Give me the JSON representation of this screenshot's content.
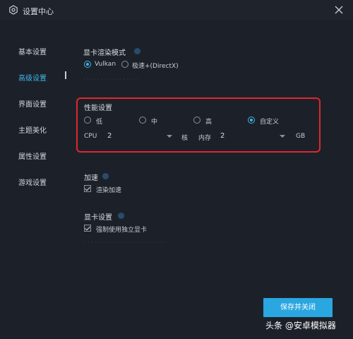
{
  "window": {
    "title": "设置中心"
  },
  "sidebar": {
    "items": [
      {
        "label": "基本设置"
      },
      {
        "label": "高级设置"
      },
      {
        "label": "界面设置"
      },
      {
        "label": "主题美化"
      },
      {
        "label": "属性设置"
      },
      {
        "label": "游戏设置"
      }
    ],
    "active_index": 1
  },
  "render": {
    "title": "显卡渲染模式",
    "option_vulkan": "Vulkan",
    "option_directx": "极速+(DirectX)",
    "selected": "Vulkan"
  },
  "performance": {
    "title": "性能设置",
    "options": [
      "低",
      "中",
      "高",
      "自定义"
    ],
    "selected": "自定义",
    "cpu_label": "CPU",
    "cpu_value": "2",
    "cpu_unit": "核",
    "memory_label": "内存",
    "memory_value": "2",
    "memory_unit": "GB"
  },
  "acceleration": {
    "title": "加速",
    "render_accel_label": "渲染加速",
    "render_accel_checked": true
  },
  "gpu": {
    "title": "显卡设置",
    "force_dgpu_label": "强制使用独立显卡",
    "force_dgpu_checked": true
  },
  "footer": {
    "save_label": "保存并关闭"
  },
  "watermark": {
    "text": "头条 @安卓模拟器"
  },
  "colors": {
    "accent": "#2aa6e0",
    "highlight_border": "#e0262a",
    "background": "#1c2129"
  }
}
